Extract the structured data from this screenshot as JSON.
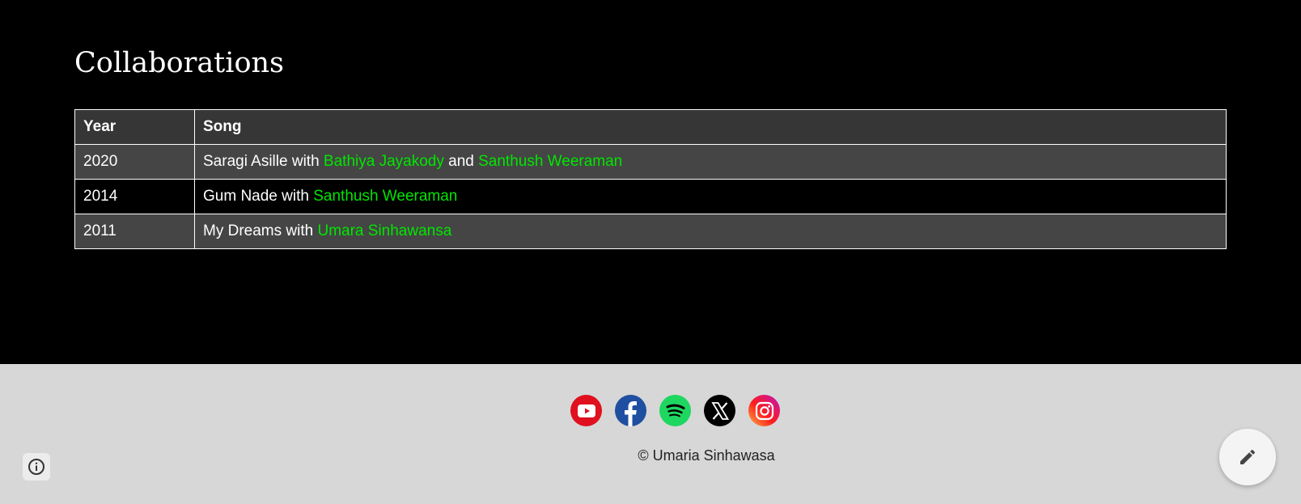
{
  "section": {
    "title": "Collaborations"
  },
  "table": {
    "headers": {
      "year": "Year",
      "song": "Song"
    },
    "rows": [
      {
        "year": "2020",
        "song": "Saragi Asille",
        "with": " with ",
        "artist1": "Bathiya Jayakody",
        "joiner": " and ",
        "artist2": "Santhush Weeraman"
      },
      {
        "year": "2014",
        "song": "Gum Nade",
        "with": " with ",
        "artist1": "Santhush Weeraman"
      },
      {
        "year": "2011",
        "song": "My Dreams",
        "with": " with ",
        "artist1": "Umara Sinhawansa"
      }
    ]
  },
  "footer": {
    "socials": [
      {
        "name": "youtube",
        "icon": "youtube-icon",
        "color": "#e0101e"
      },
      {
        "name": "facebook",
        "icon": "facebook-icon",
        "color": "#1f4fa0"
      },
      {
        "name": "spotify",
        "icon": "spotify-icon",
        "color": "#1ed760"
      },
      {
        "name": "x",
        "icon": "x-icon",
        "color": "#000000"
      },
      {
        "name": "instagram",
        "icon": "instagram-icon",
        "color": "#e1306c"
      }
    ],
    "copyright": "© Umaria Sinhawasa"
  },
  "controls": {
    "info_icon": "info-icon",
    "edit_icon": "pencil-icon"
  },
  "colors": {
    "background": "#000000",
    "link": "#00e600",
    "footer_bg": "#d7d7d7"
  }
}
